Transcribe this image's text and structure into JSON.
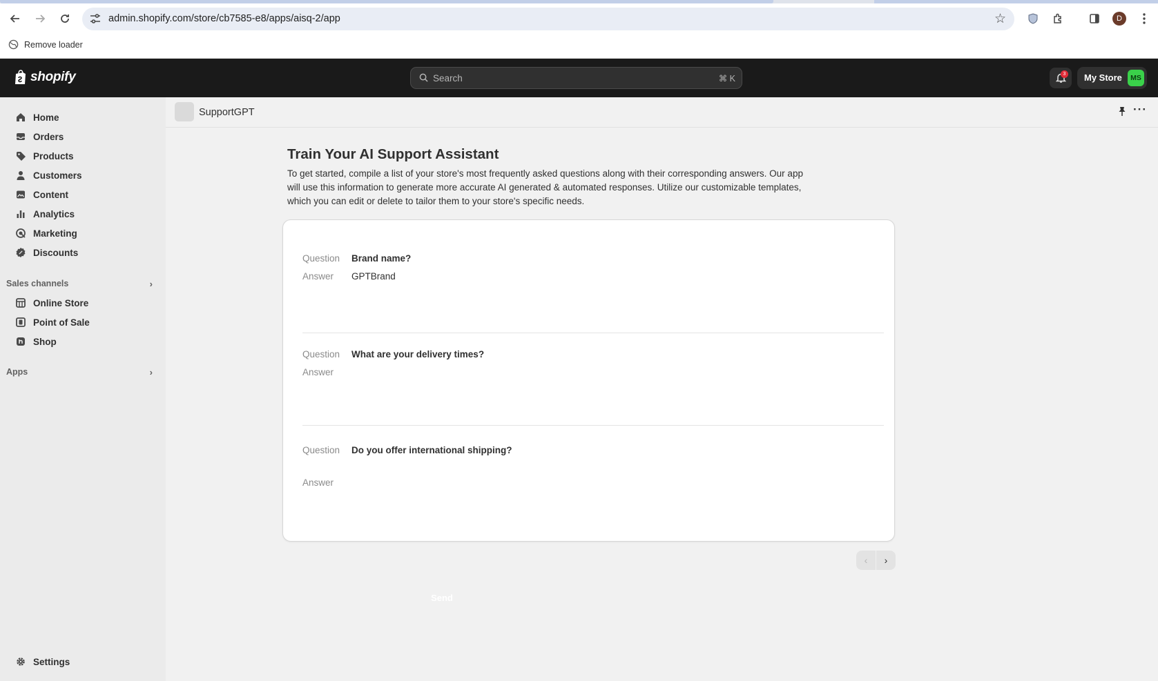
{
  "browser": {
    "url": "admin.shopify.com/store/cb7585-e8/apps/aisq-2/app",
    "profile_initial": "D",
    "bookmark_label": "Remove loader"
  },
  "topbar": {
    "logo_text": "shopify",
    "search_placeholder": "Search",
    "search_shortcut": "⌘ K",
    "notification_count": "3",
    "store_name": "My Store",
    "store_avatar": "MS",
    "avatar_color": "#3ad14a"
  },
  "sidebar": {
    "items": [
      {
        "label": "Home",
        "icon": "home-icon"
      },
      {
        "label": "Orders",
        "icon": "inbox-icon"
      },
      {
        "label": "Products",
        "icon": "tag-icon"
      },
      {
        "label": "Customers",
        "icon": "person-icon"
      },
      {
        "label": "Content",
        "icon": "image-icon"
      },
      {
        "label": "Analytics",
        "icon": "bar-chart-icon"
      },
      {
        "label": "Marketing",
        "icon": "target-icon"
      },
      {
        "label": "Discounts",
        "icon": "discount-icon"
      }
    ],
    "sales_channels_label": "Sales channels",
    "channels": [
      {
        "label": "Online Store",
        "icon": "store-icon"
      },
      {
        "label": "Point of Sale",
        "icon": "pos-icon"
      },
      {
        "label": "Shop",
        "icon": "shop-icon"
      }
    ],
    "apps_label": "Apps",
    "settings_label": "Settings"
  },
  "app": {
    "title": "SupportGPT",
    "heading": "Train Your AI Support Assistant",
    "intro": "To get started, compile a list of your store's most frequently asked questions along with their corresponding answers. Our app will use this information to generate more accurate AI generated & automated responses. Utilize our customizable templates, which you can edit or delete to tailor them to your store's specific needs.",
    "question_label": "Question",
    "answer_label": "Answer",
    "faqs": [
      {
        "question": "Brand name?",
        "answer": "GPTBrand"
      },
      {
        "question": "What are your delivery times?",
        "answer": ""
      },
      {
        "question": "Do you offer international shipping?",
        "answer": ""
      }
    ],
    "send_label": "Send"
  }
}
